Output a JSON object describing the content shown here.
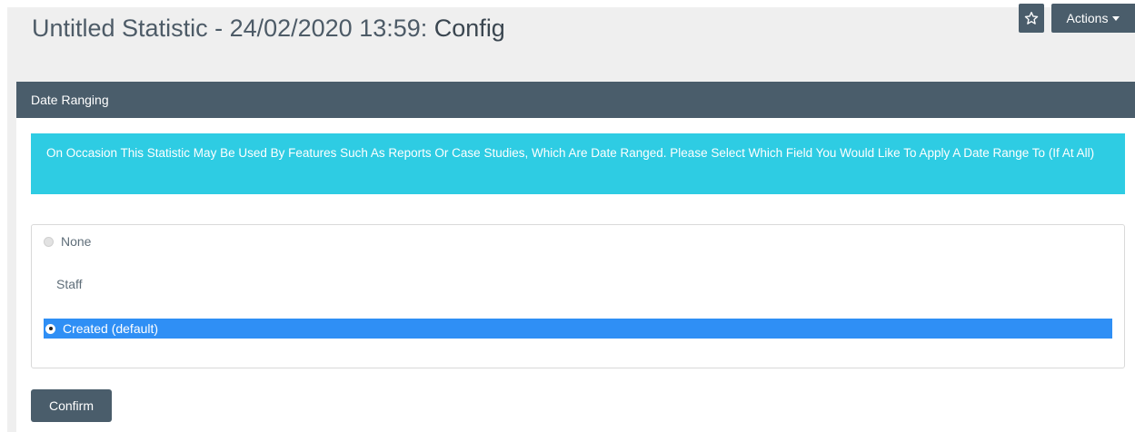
{
  "header": {
    "title": "Untitled Statistic - 24/02/2020 13:59: ",
    "title_suffix": "Config",
    "favourite_icon": "star-icon",
    "actions_label": "Actions"
  },
  "panel": {
    "heading": "Date Ranging",
    "info_text": "On Occasion This Statistic May Be Used By Features Such As Reports Or Case Studies, Which Are Date Ranged. Please Select Which Field You Would Like To Apply A Date Range To (If At All)",
    "options": {
      "none_label": "None",
      "group_label": "Staff",
      "created_label": "Created (default)",
      "selected": "created"
    },
    "confirm_label": "Confirm"
  },
  "colors": {
    "header_dark": "#4a5d6b",
    "info_cyan": "#2ecce3",
    "selection_blue": "#2f8ff5",
    "band_grey": "#efefef"
  }
}
